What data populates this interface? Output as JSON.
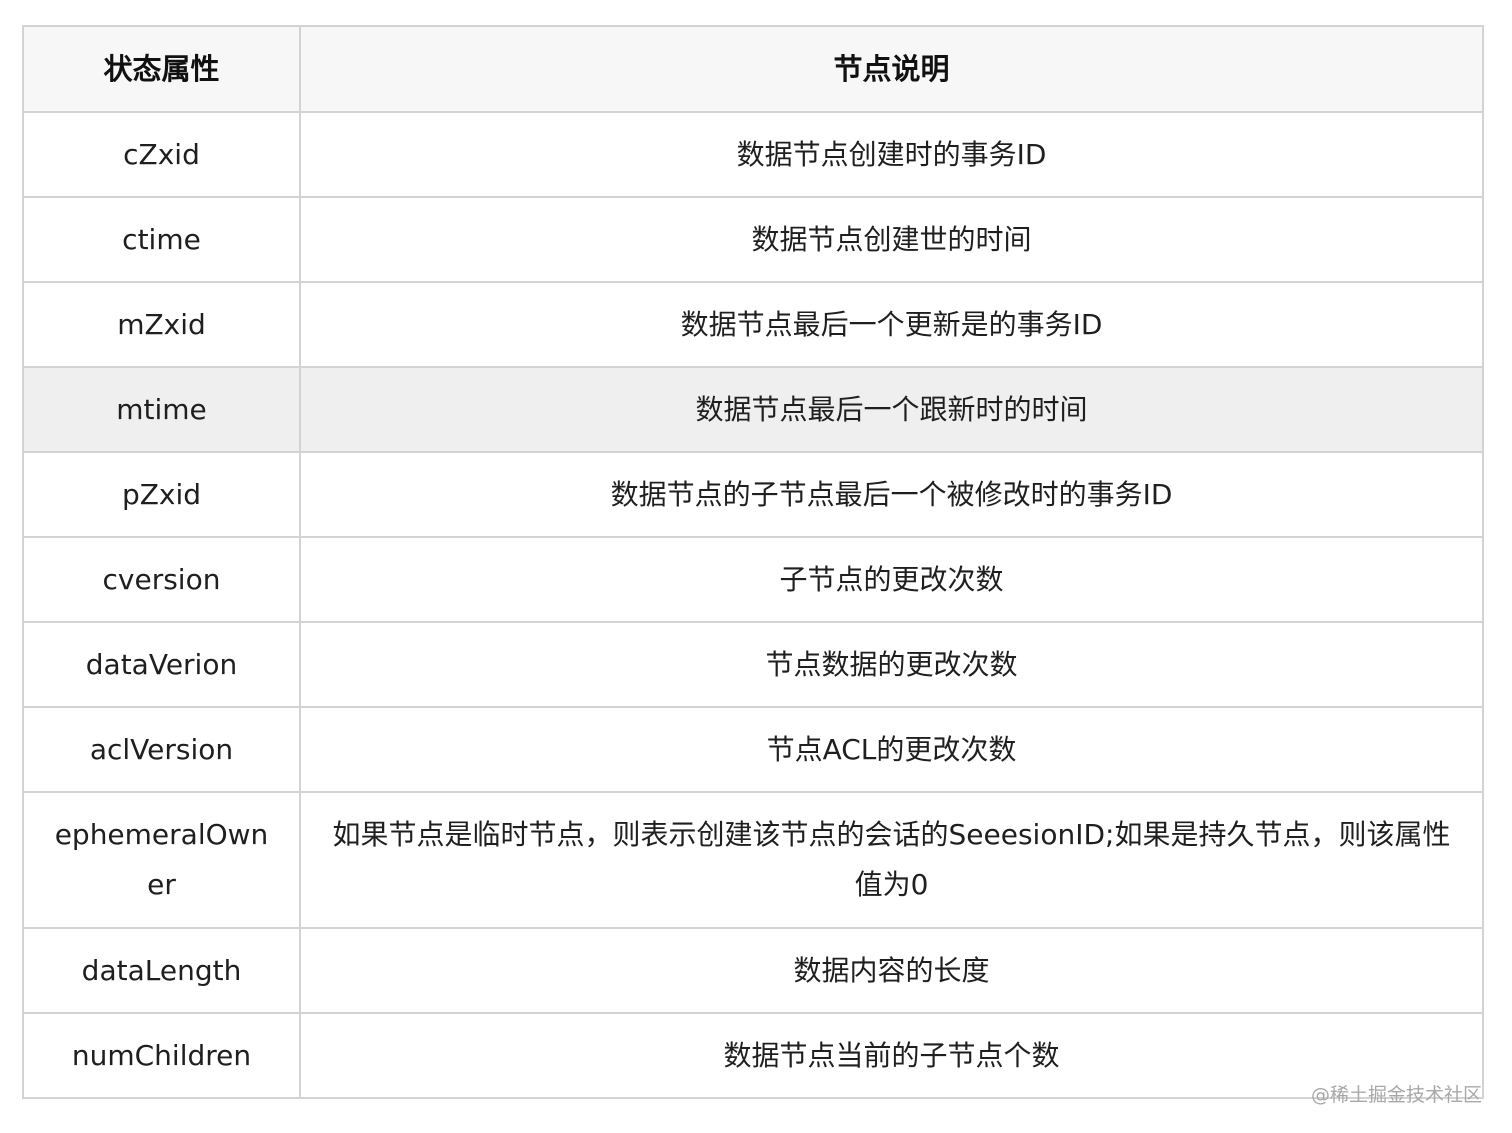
{
  "table": {
    "headers": {
      "attribute": "状态属性",
      "description": "节点说明"
    },
    "rows": [
      {
        "attribute": "cZxid",
        "description": "数据节点创建时的事务ID"
      },
      {
        "attribute": "ctime",
        "description": "数据节点创建世的时间"
      },
      {
        "attribute": "mZxid",
        "description": "数据节点最后一个更新是的事务ID"
      },
      {
        "attribute": "mtime",
        "description": "数据节点最后一个跟新时的时间"
      },
      {
        "attribute": "pZxid",
        "description": "数据节点的子节点最后一个被修改时的事务ID"
      },
      {
        "attribute": "cversion",
        "description": "子节点的更改次数"
      },
      {
        "attribute": "dataVerion",
        "description": "节点数据的更改次数"
      },
      {
        "attribute": "aclVersion",
        "description": "节点ACL的更改次数"
      },
      {
        "attribute": "ephemeralOwner",
        "description": "如果节点是临时节点，则表示创建该节点的会话的SeeesionID;如果是持久节点，则该属性值为0"
      },
      {
        "attribute": "dataLength",
        "description": "数据内容的长度"
      },
      {
        "attribute": "numChildren",
        "description": "数据节点当前的子节点个数"
      }
    ]
  },
  "watermark": "@稀土掘金技术社区"
}
